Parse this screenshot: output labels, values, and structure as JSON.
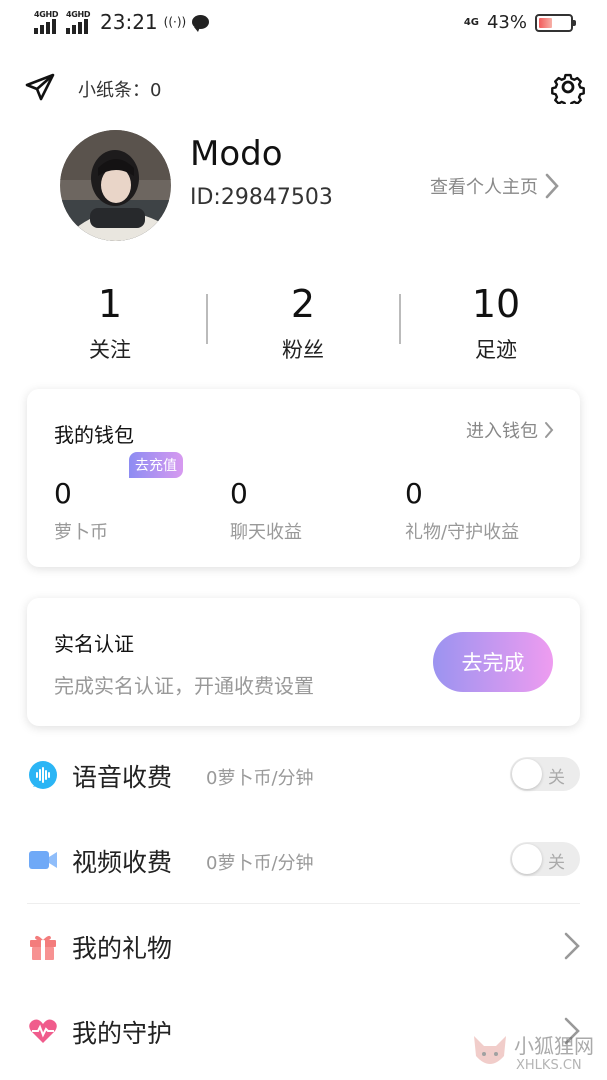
{
  "status_bar": {
    "network_left_1": "4GHD",
    "network_left_2": "4GHD",
    "time": "23:21",
    "network_right": "4G",
    "battery_percent": "43%",
    "battery_level": 0.43
  },
  "top_bar": {
    "note_label": "小纸条：0"
  },
  "profile": {
    "username": "Modo",
    "user_id": "ID:29847503",
    "view_home_label": "查看个人主页"
  },
  "stats": [
    {
      "value": "1",
      "label": "关注"
    },
    {
      "value": "2",
      "label": "粉丝"
    },
    {
      "value": "10",
      "label": "足迹"
    }
  ],
  "wallet": {
    "title": "我的钱包",
    "enter_label": "进入钱包",
    "recharge_badge": "去充值",
    "items": [
      {
        "value": "0",
        "label": "萝卜币"
      },
      {
        "value": "0",
        "label": "聊天收益"
      },
      {
        "value": "0",
        "label": "礼物/守护收益"
      }
    ]
  },
  "verify": {
    "title": "实名认证",
    "description": "完成实名认证，开通收费设置",
    "button_label": "去完成"
  },
  "settings": {
    "voice": {
      "title": "语音收费",
      "rate": "0萝卜币/分钟",
      "toggle_label": "关",
      "enabled": false
    },
    "video": {
      "title": "视频收费",
      "rate": "0萝卜币/分钟",
      "toggle_label": "关",
      "enabled": false
    }
  },
  "menu": {
    "gifts": "我的礼物",
    "guard": "我的守护"
  },
  "watermark": {
    "cn": "小狐狸网",
    "en": "XHLKS.CN"
  },
  "colors": {
    "accent_gradient_start": "#9b93f0",
    "accent_gradient_end": "#ee9cf0",
    "voice_icon": "#2bb5f5",
    "video_icon": "#6fa9f7",
    "gift_icon": "#f37c7c",
    "guard_icon": "#f05c8c"
  },
  "icons": {
    "send": "paper-plane-icon",
    "settings": "gear-icon",
    "voice": "sound-wave-icon",
    "video": "video-camera-icon",
    "gift": "gift-icon",
    "guard": "heart-pulse-icon"
  }
}
